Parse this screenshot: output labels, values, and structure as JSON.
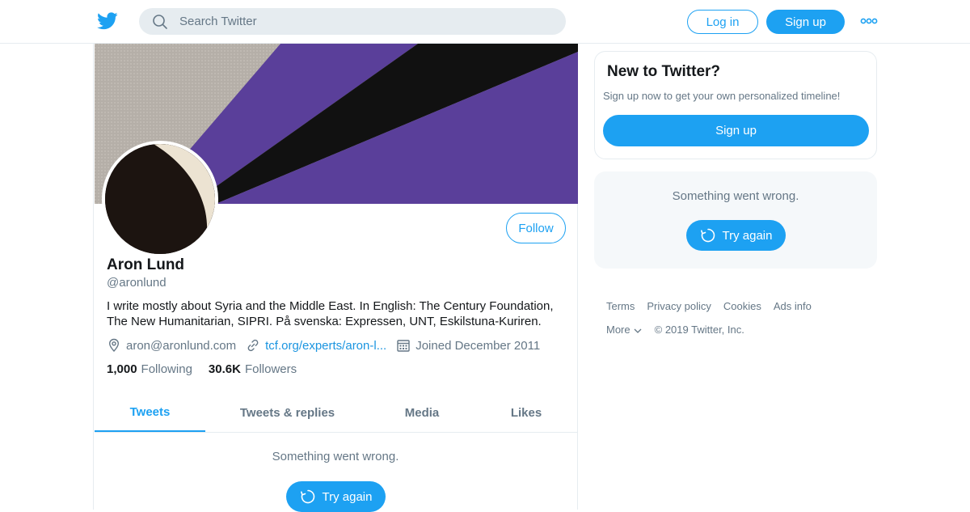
{
  "header": {
    "search_placeholder": "Search Twitter",
    "login_label": "Log in",
    "signup_label": "Sign up"
  },
  "profile": {
    "name": "Aron Lund",
    "handle": "@aronlund",
    "follow_label": "Follow",
    "bio": "I write mostly about Syria and the Middle East. In English: The Century Foundation, The New Humanitarian, SIPRI. På svenska: Expressen, UNT, Eskilstuna-Kuriren.",
    "location": "aron@aronlund.com",
    "website": "tcf.org/experts/aron-l...",
    "joined": "Joined December 2011",
    "following_count": "1,000",
    "following_label": "Following",
    "followers_count": "30.6K",
    "followers_label": "Followers"
  },
  "tabs": [
    {
      "label": "Tweets",
      "active": true
    },
    {
      "label": "Tweets & replies",
      "active": false
    },
    {
      "label": "Media",
      "active": false
    },
    {
      "label": "Likes",
      "active": false
    }
  ],
  "timeline": {
    "error_text": "Something went wrong.",
    "retry_label": "Try again"
  },
  "sidebar": {
    "new_title": "New to Twitter?",
    "new_subtitle": "Sign up now to get your own personalized timeline!",
    "signup_label": "Sign up",
    "error_text": "Something went wrong.",
    "retry_label": "Try again",
    "footer_links": [
      "Terms",
      "Privacy policy",
      "Cookies",
      "Ads info"
    ],
    "more_label": "More",
    "copyright": "© 2019 Twitter, Inc."
  },
  "colors": {
    "accent": "#1da1f2",
    "banner_purple": "#5a3f9a",
    "banner_black": "#111111",
    "banner_gray": "#b7b1aa"
  },
  "icons": [
    "twitter-logo-icon",
    "search-icon",
    "more-dots-icon",
    "location-icon",
    "link-icon",
    "calendar-icon",
    "refresh-icon",
    "chevron-down-icon"
  ]
}
